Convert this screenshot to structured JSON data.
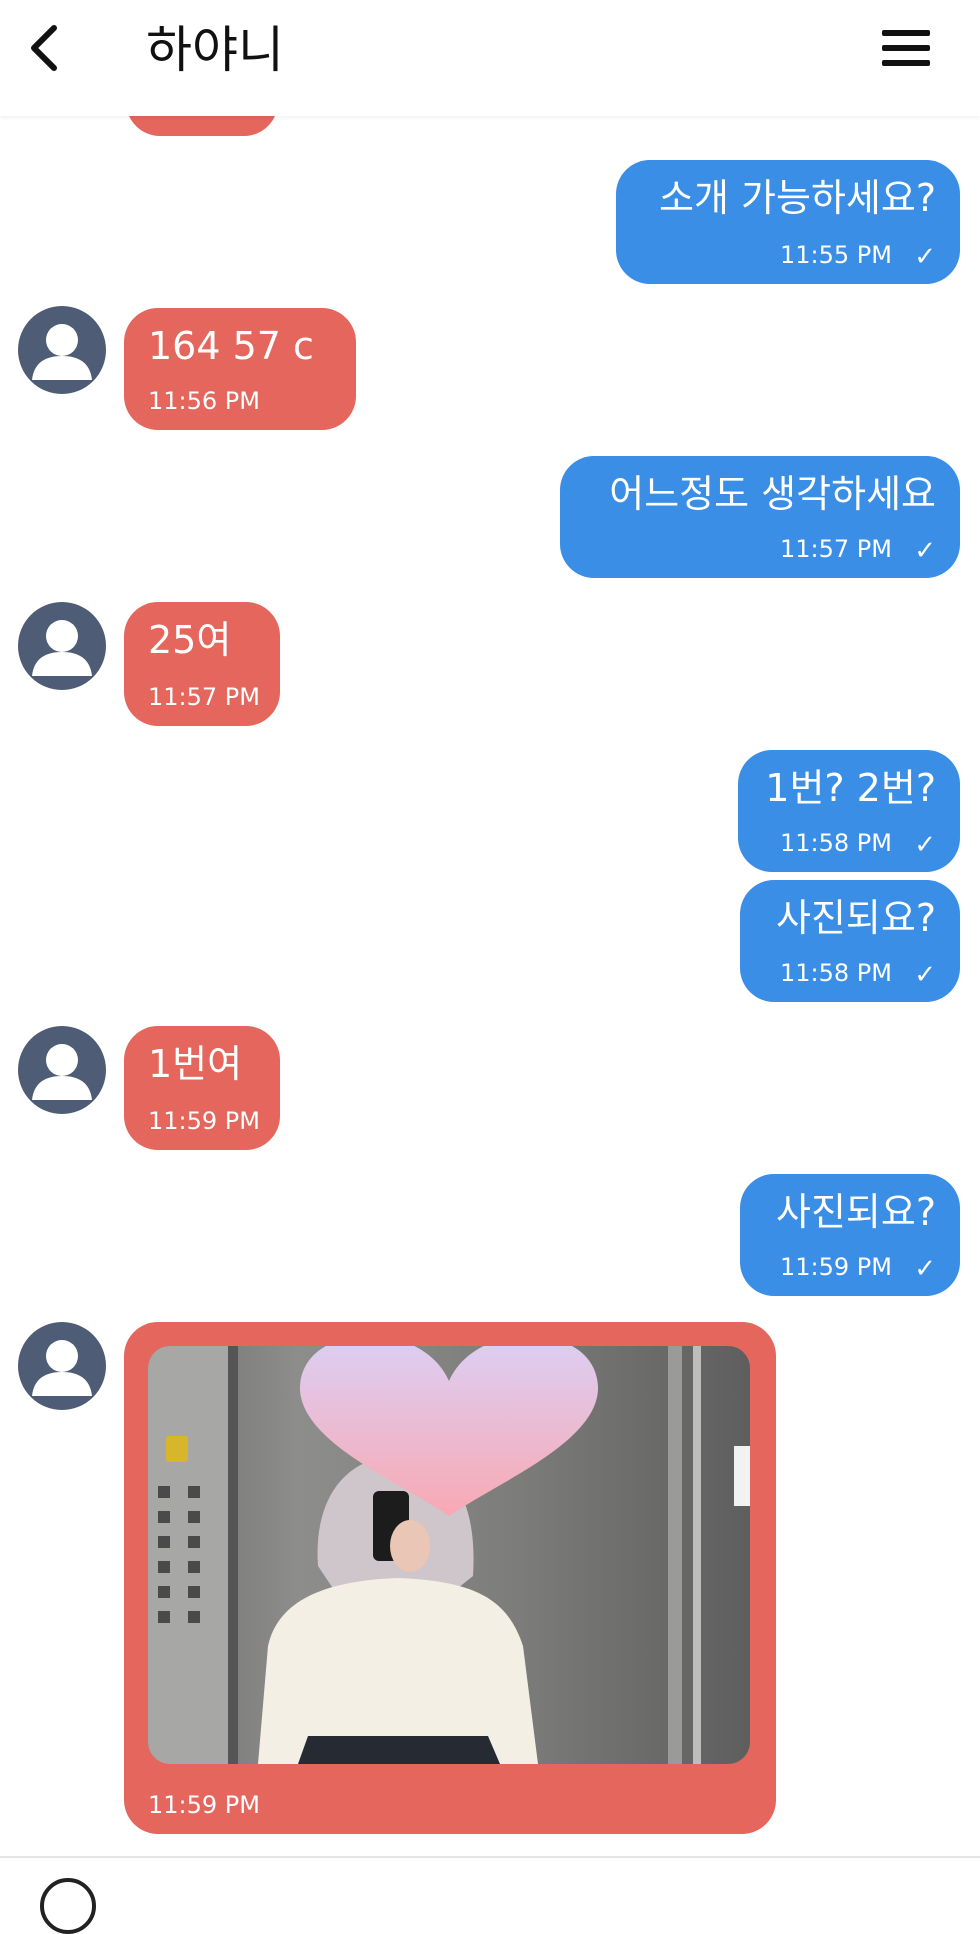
{
  "header": {
    "back_icon": "chevron-left-icon",
    "title": "하야니",
    "menu_icon": "hamburger-menu-icon"
  },
  "messages": [
    {
      "side": "in",
      "text": "",
      "time": "",
      "partial": true
    },
    {
      "side": "out",
      "text": "소개 가능하세요?",
      "time": "11:55 PM",
      "status": "✓"
    },
    {
      "side": "in",
      "text": "164  57  c",
      "time": "11:56 PM"
    },
    {
      "side": "out",
      "text": "어느정도 생각하세요",
      "time": "11:57 PM",
      "status": "✓"
    },
    {
      "side": "in",
      "text": "25여",
      "time": "11:57 PM"
    },
    {
      "side": "out",
      "text": "1번? 2번?",
      "time": "11:58 PM",
      "status": "✓"
    },
    {
      "side": "out",
      "text": "사진되요?",
      "time": "11:58 PM",
      "status": "✓"
    },
    {
      "side": "in",
      "text": "1번여",
      "time": "11:59 PM"
    },
    {
      "side": "out",
      "text": "사진되요?",
      "time": "11:59 PM",
      "status": "✓"
    },
    {
      "side": "in",
      "type": "photo",
      "time": "11:59 PM"
    }
  ],
  "colors": {
    "outgoing_bubble": "#3a8ee6",
    "incoming_bubble": "#e5665c",
    "avatar": "#4e5d75",
    "heart_top": "#dccff5",
    "heart_bottom": "#f8a9b3"
  }
}
